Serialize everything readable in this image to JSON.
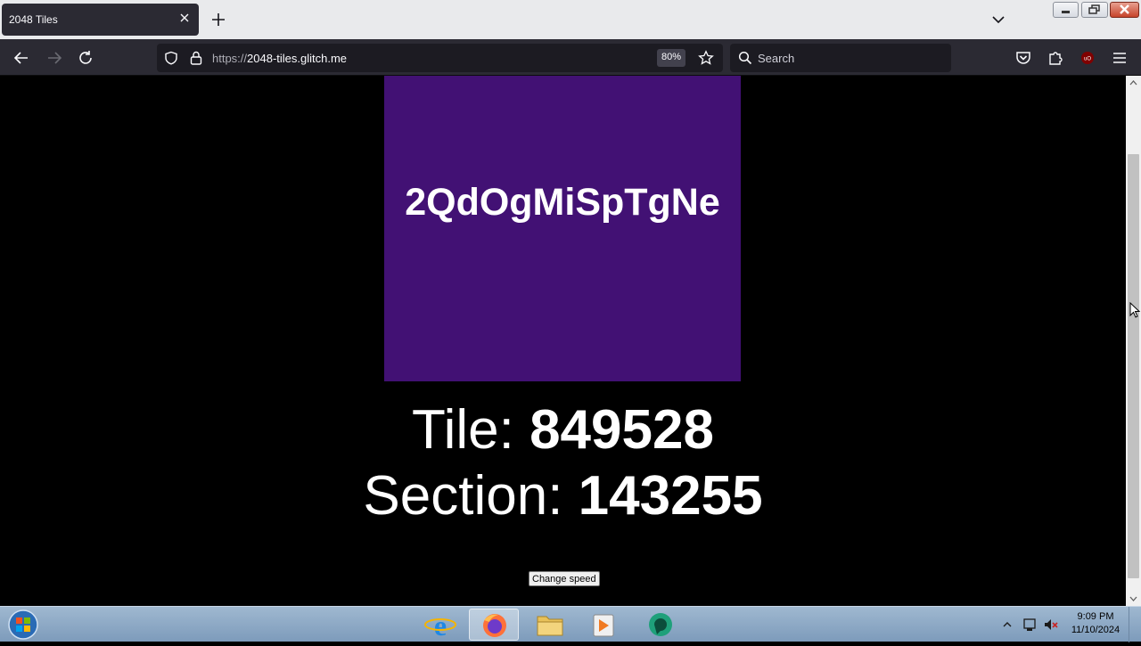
{
  "browser": {
    "tab_title": "2048 Tiles",
    "url_prefix": "https://",
    "url_host": "2048-tiles.glitch.me",
    "zoom_level": "80%",
    "search_placeholder": "Search",
    "extension_badge": "uO"
  },
  "page": {
    "tile_code": "2QdOgMiSpTgNe",
    "tile_color": "#421174",
    "tile_label": "Tile: ",
    "tile_value": "849528",
    "section_label": "Section: ",
    "section_value": "143255",
    "change_speed_label": "Change speed"
  },
  "taskbar": {
    "time": "9:09 PM",
    "date": "11/10/2024"
  }
}
